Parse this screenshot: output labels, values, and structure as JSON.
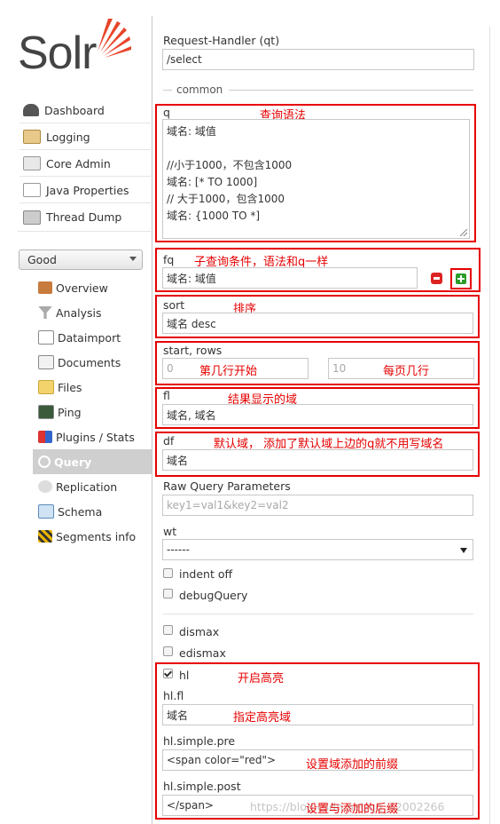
{
  "logo": {
    "text": "Solr"
  },
  "sidebar": {
    "items": [
      {
        "label": "Dashboard",
        "icon": "dashboard-icon"
      },
      {
        "label": "Logging",
        "icon": "logging-icon"
      },
      {
        "label": "Core Admin",
        "icon": "core-admin-icon"
      },
      {
        "label": "Java Properties",
        "icon": "java-properties-icon"
      },
      {
        "label": "Thread Dump",
        "icon": "thread-dump-icon"
      }
    ],
    "core_select": {
      "value": "Good"
    },
    "core_items": [
      {
        "label": "Overview",
        "icon": "home-icon"
      },
      {
        "label": "Analysis",
        "icon": "funnel-icon"
      },
      {
        "label": "Dataimport",
        "icon": "dataimport-icon"
      },
      {
        "label": "Documents",
        "icon": "documents-icon"
      },
      {
        "label": "Files",
        "icon": "files-icon"
      },
      {
        "label": "Ping",
        "icon": "ping-icon"
      },
      {
        "label": "Plugins / Stats",
        "icon": "plugins-icon"
      },
      {
        "label": "Query",
        "icon": "search-icon",
        "active": true
      },
      {
        "label": "Replication",
        "icon": "replication-icon"
      },
      {
        "label": "Schema",
        "icon": "schema-icon"
      },
      {
        "label": "Segments info",
        "icon": "segments-icon"
      }
    ]
  },
  "form": {
    "request_handler": {
      "label": "Request-Handler (qt)",
      "value": "/select"
    },
    "common_legend": "common",
    "q": {
      "label": "q",
      "lines": [
        "域名: 域值",
        "",
        "//小于1000，不包含1000",
        "域名: [* TO 1000]",
        "// 大于1000，包含1000",
        "域名: {1000 TO *]"
      ]
    },
    "fq": {
      "label": "fq",
      "value": "域名: 域值"
    },
    "sort": {
      "label": "sort",
      "value": "域名 desc"
    },
    "start_rows": {
      "label": "start, rows",
      "start": "0",
      "rows": "10"
    },
    "fl": {
      "label": "fl",
      "value": "域名, 域名"
    },
    "df": {
      "label": "df",
      "value": "域名"
    },
    "raw": {
      "label": "Raw Query Parameters",
      "placeholder": "key1=val1&key2=val2"
    },
    "wt": {
      "label": "wt",
      "value": "------"
    },
    "checkboxes": {
      "indent": "indent off",
      "debug": "debugQuery",
      "dismax": "dismax",
      "edismax": "edismax"
    },
    "hl": {
      "label": "hl",
      "checked": true
    },
    "hl_fl": {
      "label": "hl.fl",
      "value": "域名"
    },
    "hl_pre": {
      "label": "hl.simple.pre",
      "value": "<span color=\"red\">"
    },
    "hl_post": {
      "label": "hl.simple.post",
      "value": "</span>"
    }
  },
  "annotations": {
    "q": "查询语法",
    "fq": "子查询条件，语法和q一样",
    "sort": "排序",
    "start": "第几行开始",
    "rows": "每页几行",
    "fl": "结果显示的域",
    "df": "默认域， 添加了默认域上边的q就不用写域名",
    "hl": "开启高亮",
    "hl_fl": "指定高亮域",
    "hl_pre": "设置域添加的前缀",
    "hl_post": "设置与添加的后缀"
  },
  "watermark": "https://blog.csdn.net/qq_42002266",
  "colors": {
    "annotation": "#e60000",
    "logo_orange": "#e8442a",
    "active_nav": "#cfcfcf"
  }
}
